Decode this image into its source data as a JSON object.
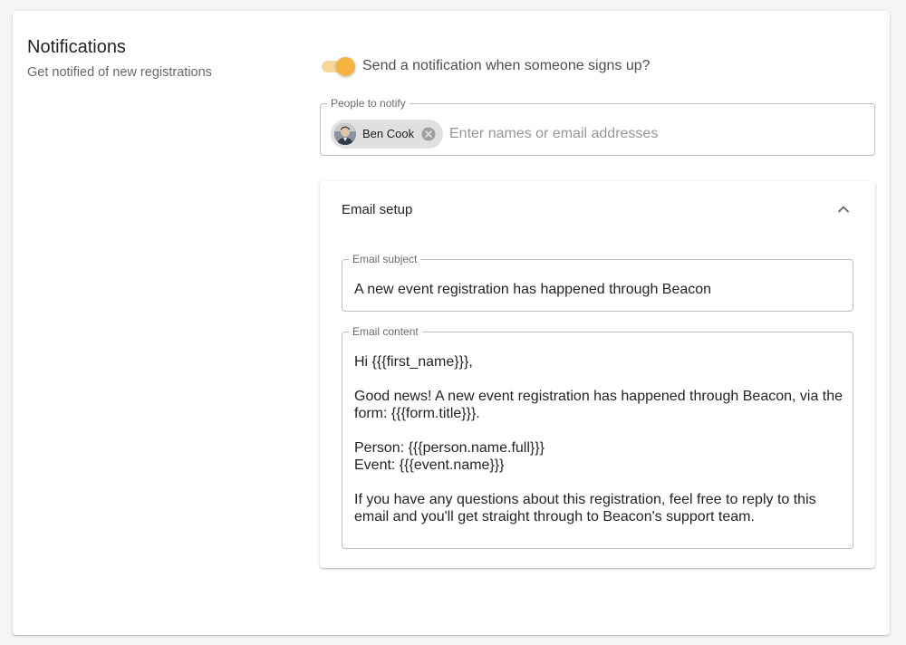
{
  "section": {
    "title": "Notifications",
    "subtitle": "Get notified of new registrations"
  },
  "toggle": {
    "label": "Send a notification when someone signs up?",
    "on": true
  },
  "people": {
    "legend": "People to notify",
    "chips": [
      {
        "label": "Ben Cook",
        "avatar": "person-avatar-photo",
        "remove_icon": "cancel-icon"
      }
    ],
    "placeholder": "Enter names or email addresses",
    "value": ""
  },
  "email_setup": {
    "title": "Email setup",
    "expanded": true,
    "collapse_icon": "chevron-up-icon",
    "subject": {
      "legend": "Email subject",
      "value": "A new event registration has happened through Beacon"
    },
    "content": {
      "legend": "Email content",
      "value": "Hi {{{first_name}}},\n\nGood news! A new event registration has happened through Beacon, via the form: {{{form.title}}}.\n\nPerson: {{{person.name.full}}}\nEvent: {{{event.name}}}\n\nIf you have any questions about this registration, feel free to reply to this email and you'll get straight through to Beacon's support team."
    }
  },
  "colors": {
    "accent": "#f5b342",
    "accent_track": "#f7d79b",
    "chip_bg": "#e0e0e0",
    "page_bg": "#f5f5f5"
  }
}
